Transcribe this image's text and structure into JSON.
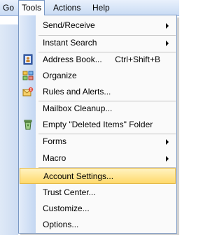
{
  "menubar": [
    "Go",
    "Tools",
    "Actions",
    "Help"
  ],
  "active_menu": "Tools",
  "menu": {
    "send_receive": "Send/Receive",
    "instant_search": "Instant Search",
    "address_book": "Address Book...",
    "address_book_shortcut": "Ctrl+Shift+B",
    "organize": "Organize",
    "rules_alerts": "Rules and Alerts...",
    "mailbox_cleanup": "Mailbox Cleanup...",
    "empty_deleted": "Empty \"Deleted Items\" Folder",
    "forms": "Forms",
    "macro": "Macro",
    "account_settings": "Account Settings...",
    "trust_center": "Trust Center...",
    "customize": "Customize...",
    "options": "Options..."
  },
  "highlighted_item": "Account Settings...",
  "colors": {
    "highlight": "#ffd96b",
    "menubar": "#c8daf3"
  }
}
